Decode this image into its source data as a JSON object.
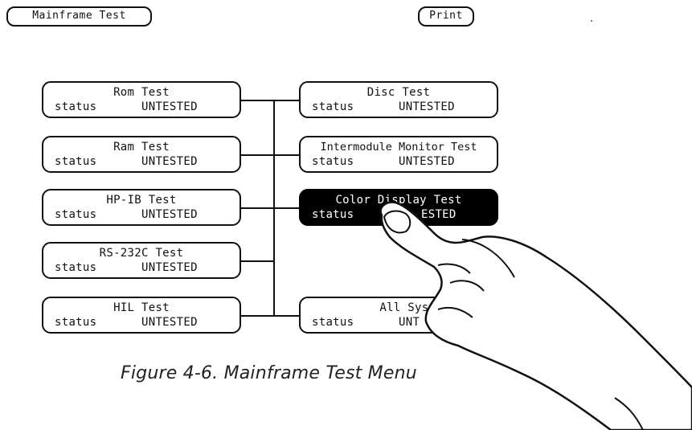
{
  "header": {
    "title_button": "Mainframe Test",
    "print_button": "Print"
  },
  "left_tests": [
    {
      "name": "Rom Test",
      "status_label": "status",
      "status": "UNTESTED"
    },
    {
      "name": "Ram Test",
      "status_label": "status",
      "status": "UNTESTED"
    },
    {
      "name": "HP-IB Test",
      "status_label": "status",
      "status": "UNTESTED"
    },
    {
      "name": "RS-232C Test",
      "status_label": "status",
      "status": "UNTESTED"
    },
    {
      "name": "HIL Test",
      "status_label": "status",
      "status": "UNTESTED"
    }
  ],
  "right_tests": [
    {
      "name": "Disc Test",
      "status_label": "status",
      "status": "UNTESTED"
    },
    {
      "name": "Intermodule Monitor Test",
      "status_label": "status",
      "status": "UNTESTED"
    },
    {
      "name": "Color Display Test",
      "status_label": "status",
      "status": "ESTED",
      "selected": true
    },
    {
      "name": "All System",
      "status_label": "status",
      "status": "UNT"
    }
  ],
  "caption": "Figure 4-6. Mainframe Test Menu",
  "colors": {
    "ink": "#111111",
    "selected_bg": "#000000",
    "background": "#ffffff"
  },
  "icons": [
    "pointing-hand-icon"
  ]
}
